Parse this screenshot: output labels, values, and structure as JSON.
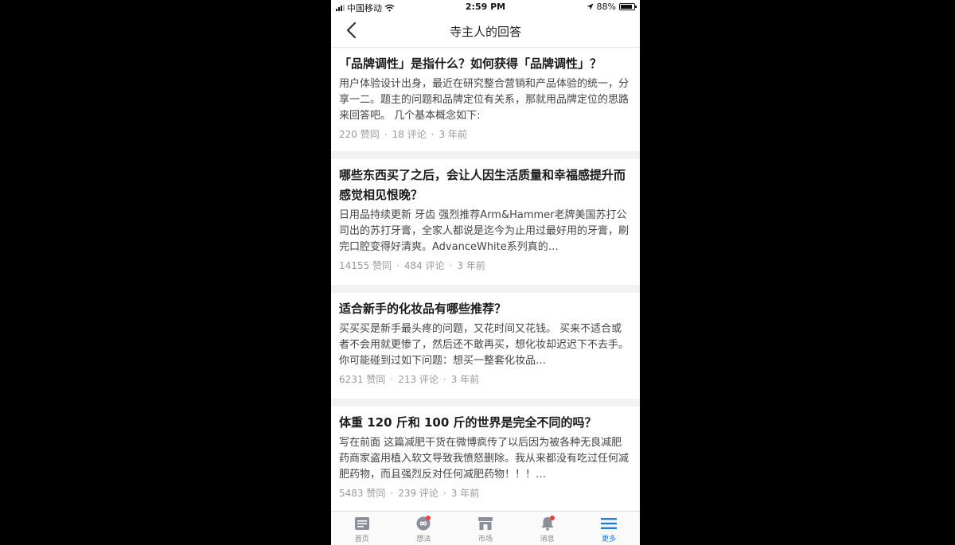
{
  "status_bar": {
    "carrier": "中国移动",
    "time": "2:59 PM",
    "battery": "88%"
  },
  "nav": {
    "title": "寺主人的回答"
  },
  "answers": [
    {
      "title": "「品牌调性」是指什么？如何获得「品牌调性」？",
      "excerpt": "用户体验设计出身，最近在研究整合营销和产品体验的统一，分享一二。题主的问题和品牌定位有关系，那就用品牌定位的思路来回答吧。 几个基本概念如下:",
      "likes": "220 赞同",
      "comments": "18 评论",
      "time": "3 年前"
    },
    {
      "title": "哪些东西买了之后，会让人因生活质量和幸福感提升而感觉相见恨晚？",
      "excerpt": "日用品持续更新 牙齿 强烈推荐Arm&Hammer老牌美国苏打公司出的苏打牙膏，全家人都说是迄今为止用过最好用的牙膏，刷完口腔变得好清爽。AdvanceWhite系列真的…",
      "likes": "14155 赞同",
      "comments": "484 评论",
      "time": "3 年前"
    },
    {
      "title": "适合新手的化妆品有哪些推荐？",
      "excerpt": "买买买是新手最头疼的问题，又花时间又花钱。 买来不适合或者不会用就更惨了，然后还不敢再买，想化妆却迟迟下不去手。 你可能碰到过如下问题：想买一整套化妆品…",
      "likes": "6231 赞同",
      "comments": "213 评论",
      "time": "3 年前"
    },
    {
      "title": "体重 120 斤和 100 斤的世界是完全不同的吗？",
      "excerpt": "写在前面 这篇减肥干货在微博疯传了以后因为被各种无良减肥药商家盗用植入软文导致我愤怒删除。我从来都没有吃过任何减肥药物，而且强烈反对任何减肥药物！！！…",
      "likes": "5483 赞同",
      "comments": "239 评论",
      "time": "3 年前"
    }
  ],
  "tabs": [
    {
      "label": "首页",
      "icon": "home-icon",
      "badge": false,
      "active": false
    },
    {
      "label": "想法",
      "icon": "ideas-icon",
      "badge": true,
      "active": false
    },
    {
      "label": "市场",
      "icon": "market-icon",
      "badge": false,
      "active": false
    },
    {
      "label": "消息",
      "icon": "bell-icon",
      "badge": true,
      "active": false
    },
    {
      "label": "更多",
      "icon": "menu-icon",
      "badge": false,
      "active": true
    }
  ],
  "colors": {
    "accent": "#1e7ee6",
    "badge": "#f1403c",
    "meta": "#999999"
  }
}
